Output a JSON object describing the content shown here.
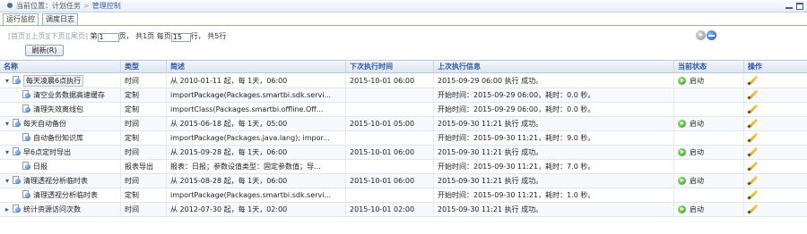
{
  "breadcrumb": {
    "prefix": "当前位置：",
    "items": [
      "计划任务",
      "管理控制"
    ],
    "separator": ">"
  },
  "tabs": [
    {
      "label": "运行监控",
      "active": true
    },
    {
      "label": "调度日志",
      "active": false
    }
  ],
  "pager": {
    "first": "[首页]",
    "prev": "[上页]",
    "next": "[下页]",
    "last": "[尾页]",
    "page_prefix": "第",
    "page_value": "1",
    "page_suffix": "页，",
    "total_pages": "共1页",
    "per_page_prefix": "每页",
    "per_page_value": "15",
    "per_page_suffix": "行，",
    "total_rows": "共5行"
  },
  "refresh_label": "刷新(R)",
  "columns": [
    "名称",
    "类型",
    "简述",
    "下次执行时间",
    "上次执行信息",
    "当前状态",
    "操作"
  ],
  "rows": [
    {
      "level": 0,
      "expander": "▾",
      "boxed": true,
      "name": "每天凌晨6点执行",
      "type": "时间",
      "desc": "从 2010-01-11 起，每 1天，06:00",
      "next": "2015-10-01 06:00",
      "last": "2015-09-29 06:00 执行 成功。",
      "status": "启动",
      "has_status": true,
      "has_edit": true
    },
    {
      "level": 1,
      "expander": "",
      "boxed": false,
      "name": "清空业务数据高速缓存",
      "type": "定制",
      "desc": "importPackage(Packages.smartbi.sdk.servi...",
      "next": "",
      "last": "开始时间：2015-09-29 06:00，耗时：0.0 秒。",
      "status": "",
      "has_status": false,
      "has_edit": true
    },
    {
      "level": 1,
      "expander": "",
      "boxed": false,
      "name": "清理失效离线包",
      "type": "定制",
      "desc": "importClass(Packages.smartbi.offline.Off...",
      "next": "",
      "last": "开始时间：2015-09-29 06:00，耗时：0.0 秒。",
      "status": "",
      "has_status": false,
      "has_edit": true
    },
    {
      "level": 0,
      "expander": "▾",
      "boxed": false,
      "name": "每天自动备份",
      "type": "时间",
      "desc": "从 2015-06-18 起，每 1天，05:00",
      "next": "2015-10-01 05:00",
      "last": "2015-09-30 11:21 执行 成功。",
      "status": "启动",
      "has_status": true,
      "has_edit": true
    },
    {
      "level": 1,
      "expander": "",
      "boxed": false,
      "name": "自动备份知识库",
      "type": "定制",
      "desc": "importPackage(Packages.java.lang); impor...",
      "next": "",
      "last": "开始时间：2015-09-30 11:21，耗时：9.0 秒。",
      "status": "",
      "has_status": false,
      "has_edit": true
    },
    {
      "level": 0,
      "expander": "▾",
      "boxed": false,
      "name": "早6点定时导出",
      "type": "时间",
      "desc": "从 2015-09-28 起，每 1天，06:00",
      "next": "2015-10-01 06:00",
      "last": "2015-09-30 11:21 执行 成功。",
      "status": "启动",
      "has_status": true,
      "has_edit": true
    },
    {
      "level": 1,
      "expander": "",
      "boxed": false,
      "name": "日报",
      "type": "报表导出",
      "desc": "报表：日报；参数设值类型：固定参数值；导...",
      "next": "",
      "last": "开始时间：2015-09-30 11:21，耗时：7.0 秒。",
      "status": "",
      "has_status": false,
      "has_edit": true
    },
    {
      "level": 0,
      "expander": "▾",
      "boxed": false,
      "name": "清理透视分析临时表",
      "type": "时间",
      "desc": "从 2015-08-28 起，每 1天，06:00",
      "next": "2015-10-01 06:00",
      "last": "2015-09-30 11:21 执行 成功。",
      "status": "启动",
      "has_status": true,
      "has_edit": true
    },
    {
      "level": 1,
      "expander": "",
      "boxed": false,
      "name": "清理透视分析临时表",
      "type": "定制",
      "desc": "importPackage(Packages.smartbi.sdk.servi...",
      "next": "",
      "last": "开始时间：2015-09-30 11:21，耗时：1.0 秒。",
      "status": "",
      "has_status": false,
      "has_edit": true
    },
    {
      "level": 0,
      "expander": "▸",
      "boxed": false,
      "name": "统计资源访问次数",
      "type": "时间",
      "desc": "从 2012-07-30 起，每 1天，02:00",
      "next": "2015-10-01 02:00",
      "last": "2015-09-30 11:21 执行 成功。",
      "status": "启动",
      "has_status": true,
      "has_edit": true
    }
  ]
}
